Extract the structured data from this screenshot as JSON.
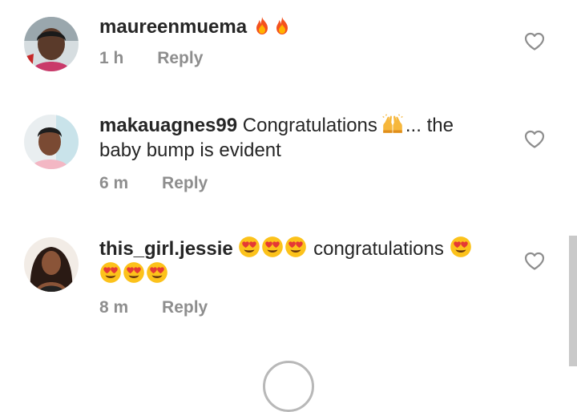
{
  "comments": [
    {
      "username": "maureenmuema",
      "text": "",
      "emojis": [
        "fire-emoji",
        "fire-emoji"
      ],
      "time": "1 h",
      "reply_label": "Reply"
    },
    {
      "username": "makauagnes99",
      "text_before_emoji": "Congratulations",
      "emojis": [
        "raising-hands-emoji"
      ],
      "text_after_emoji": "... the",
      "text_line2": "baby bump is evident",
      "time": "6 m",
      "reply_label": "Reply"
    },
    {
      "username": "this_girl.jessie",
      "emojis_line1_before": [
        "heart-eyes-emoji",
        "heart-eyes-emoji",
        "heart-eyes-emoji"
      ],
      "text": "congratulations",
      "emojis_line1_after": [
        "heart-eyes-emoji"
      ],
      "emojis_line2": [
        "heart-eyes-emoji",
        "heart-eyes-emoji",
        "heart-eyes-emoji"
      ],
      "time": "8 m",
      "reply_label": "Reply"
    }
  ],
  "colors": {
    "text": "#262626",
    "muted": "#8e8e8e",
    "heart_outline": "#8e8e8e"
  },
  "icons": [
    "heart-outline-icon",
    "fire-emoji",
    "raising-hands-emoji",
    "heart-eyes-emoji"
  ]
}
